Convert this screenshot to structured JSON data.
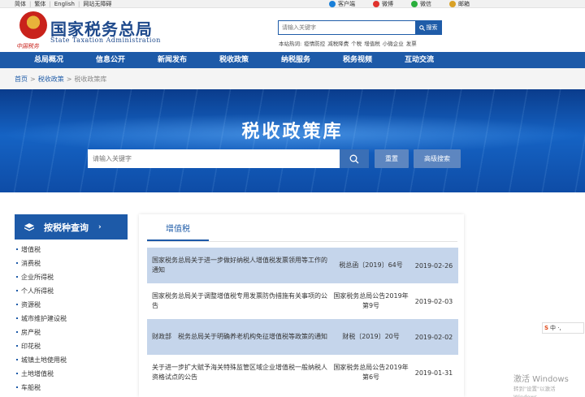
{
  "topbar": {
    "langs": [
      "简体",
      "繁体",
      "English",
      "网站无障碍"
    ],
    "links": [
      {
        "label": "客户端",
        "color": "#1a7fd8"
      },
      {
        "label": "微博",
        "color": "#e0322c"
      },
      {
        "label": "微信",
        "color": "#2aae3c"
      },
      {
        "label": "邮箱",
        "color": "#d9a126"
      }
    ]
  },
  "header": {
    "title_cn": "国家税务总局",
    "title_en": "State Taxation Administration",
    "emblem_text": "中国税务",
    "search_placeholder": "请输入关键字",
    "search_button": "搜索",
    "hot_label": "本站热词:",
    "hot_words": [
      "疫情防控",
      "减税降费",
      "个税",
      "增值税",
      "小微企业",
      "发票"
    ]
  },
  "nav": [
    "总局概况",
    "信息公开",
    "新闻发布",
    "税收政策",
    "纳税服务",
    "税务视频",
    "互动交流"
  ],
  "breadcrumb": {
    "home": "首页",
    "sep": ">",
    "level1": "税收政策",
    "current": "税收政策库"
  },
  "banner": {
    "title": "税收政策库",
    "search_placeholder": "请输入关键字",
    "reset": "重置",
    "advanced": "高级搜索"
  },
  "sidebar": {
    "title": "按税种查询",
    "items": [
      "增值税",
      "消费税",
      "企业所得税",
      "个人所得税",
      "资源税",
      "城市维护建设税",
      "房产税",
      "印花税",
      "城镇土地使用税",
      "土地增值税",
      "车船税"
    ]
  },
  "main": {
    "tab": "增值税",
    "rows": [
      {
        "title": "国家税务总局关于进一步做好纳税人增值税发票领用等工作的通知",
        "number": "税总函〔2019〕64号",
        "date": "2019-02-26"
      },
      {
        "title": "国家税务总局关于调整增值税专用发票防伪措施有关事项的公告",
        "number": "国家税务总局公告2019年第9号",
        "date": "2019-02-03"
      },
      {
        "title": "财政部　税务总局关于明确养老机构免征增值税等政策的通知",
        "number": "财税〔2019〕20号",
        "date": "2019-02-02"
      },
      {
        "title": "关于进一步扩大赋予海关特殊监管区域企业增值税一般纳税人资格试点的公告",
        "number": "国家税务总局公告2019年第6号",
        "date": "2019-01-31"
      }
    ]
  },
  "ime": {
    "logo": "S",
    "text": "中 ·,"
  },
  "watermark": {
    "line1": "激活 Windows",
    "line2": "转到\"设置\"以激活 Windows。"
  }
}
